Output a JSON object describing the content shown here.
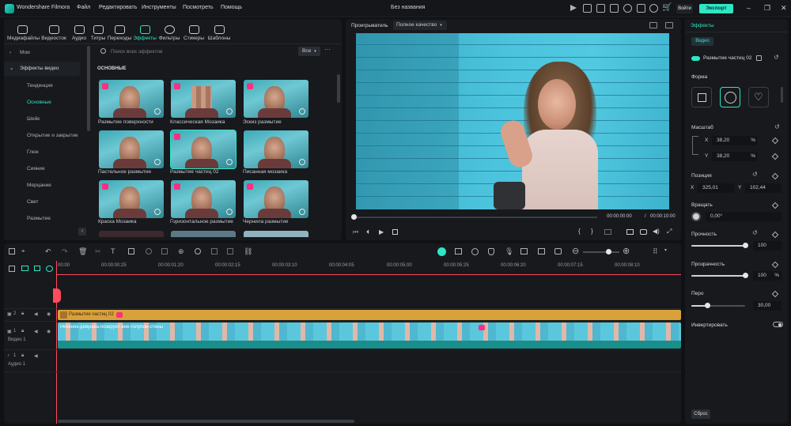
{
  "app": {
    "name": "Wondershare Filmora",
    "doc_title": "Без названия"
  },
  "menu": [
    "Файл",
    "Редактировать",
    "Инструменты",
    "Посмотреть",
    "Помощь"
  ],
  "titlebar": {
    "login": "Войти",
    "export": "Экспорт"
  },
  "media_tabs": [
    {
      "label": "Медиафайлы",
      "icon": "folder-icon"
    },
    {
      "label": "Видеосток",
      "icon": "film-icon"
    },
    {
      "label": "Аудио",
      "icon": "music-icon"
    },
    {
      "label": "Титры",
      "icon": "text-icon"
    },
    {
      "label": "Переходы",
      "icon": "transition-icon"
    },
    {
      "label": "Эффекты",
      "icon": "sparkle-icon",
      "active": true
    },
    {
      "label": "Фильтры",
      "icon": "filter-icon"
    },
    {
      "label": "Стикеры",
      "icon": "sticker-icon"
    },
    {
      "label": "Шаблоны",
      "icon": "template-icon"
    }
  ],
  "sidebar": {
    "mine": "Мои",
    "video_effects": "Эффекты видео",
    "items": [
      "Тенденция",
      "Основные",
      "Шейк",
      "Открытие и закрытие",
      "Глюк",
      "Сияние",
      "Мерцание",
      "Свет",
      "Размытие"
    ]
  },
  "search": {
    "placeholder": "Поиск всех эффектов",
    "filter": "Все"
  },
  "grid": {
    "section": "ОСНОВНЫЕ",
    "effects": [
      "Размытие поверхности",
      "Классическая Мозаика",
      "Эскиз размытие",
      "Пастельное размытие",
      "Размытие частиц 02",
      "Писанная мозаика",
      "Краска Мозаика",
      "Горизонтальное размытие",
      "Чернила размытие"
    ]
  },
  "preview": {
    "player_label": "Проигрыватель",
    "quality": "Полное качество",
    "time_current": "00:00:00:00",
    "time_sep": "/",
    "time_total": "00:00:10:00"
  },
  "timeline": {
    "ruler": [
      "00:00",
      "00:00:00:25",
      "00:00:01:20",
      "00:00:02:15",
      "00:00:03:10",
      "00:00:04:05",
      "00:00:05:00",
      "00:00:05:25",
      "00:00:06:20",
      "00:00:07:15",
      "00:00:08:10"
    ],
    "effect_clip_label": "Размытие частиц 02",
    "video_clip_label": "Ребенок-девушка-позирует-вне-голубой-стены",
    "video_track": "Видео 1",
    "audio_track": "Аудио 1",
    "track_nums": [
      "2",
      "1",
      "1"
    ]
  },
  "right": {
    "panel_tab": "Эффекты",
    "sub_tab": "Видео",
    "effect_name": "Размытие частиц 02",
    "shape_label": "Форма",
    "scale_label": "Масштаб",
    "scale_x_label": "X",
    "scale_x": "38,20",
    "scale_y_label": "Y",
    "scale_y": "38,20",
    "pct": "%",
    "position_label": "Позиция",
    "pos_x_label": "X",
    "pos_x": "325,01",
    "pos_y_label": "Y",
    "pos_y": "102,44",
    "rotate_label": "Вращать",
    "rotate_value": "0,00°",
    "strength_label": "Прочность",
    "strength_value": "100",
    "strength_level": 1.0,
    "opacity_label": "Прозрачность",
    "opacity_value": "100",
    "opacity_level": 1.0,
    "feather_label": "Перо",
    "feather_value": "30,00",
    "feather_level": 0.3,
    "invert_label": "Инвертировать",
    "reset": "Сброс"
  },
  "colors": {
    "accent": "#2ee6c5",
    "badge": "#ff2e7e",
    "playhead": "#ff4b5c",
    "effect_track": "#d9a13a",
    "video_track": "#1a8e8a"
  }
}
